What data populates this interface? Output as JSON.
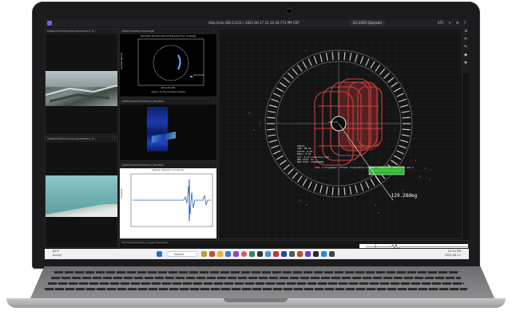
{
  "titlebar": {
    "url": "http://orb-308:11311 / 2025-06-17 12:14:18.773 PM CDT",
    "layout": "G3 2025 Operator",
    "right_items": [
      "UTC",
      "⚲",
      "⚙",
      "?"
    ]
  },
  "panels": {
    "cam_top": {
      "title": "/sibot/vehicle/cameras/camera_fr..."
    },
    "polar": {
      "title": "/sibot/sipedal/coverage",
      "plot_title": "Fwd Right Tank Bounded Alt Expected Floor Coverage",
      "ylabel": "Depth/Height (ft)",
      "xlabel": "Aft-to-Fwd (ft)",
      "legend": "Good Data",
      "footer": "Approx. 2x Floor Surface Covered"
    },
    "scan_blue": {
      "title": "/sibot/whale/sidescan_banded"
    },
    "sonar_plot": {
      "title": "/sibot/whale/sidescan_banded",
      "plot_title": "Sidescan Waveform & Intensity",
      "ylabel": "Amplitude"
    },
    "cam_bottom": {
      "title": "/sibot/vehicle/cameras/camera_fr..."
    },
    "main3d": {
      "title": "",
      "info_lines": [
        "TRACK:",
        "YAW: 98.44",
        "PITCH: 0.03",
        "ROLL: 0.01",
        "ALT: 0.75 Clearance_TOP",
        "MFR STAT: 81",
        "MLR STAT: 418491000"
      ],
      "caption": "Tank 3 Alignment: Offset translation between Inspection Session 2 and 3",
      "heading": "-129.28deg",
      "center_label": "vehicle"
    },
    "bottom_strip": {
      "title": "/sibot/whale/sidescan_image/compressed"
    }
  },
  "sidebar": {
    "icons": [
      "⇲",
      "✕",
      "✎",
      "◆",
      "✥"
    ]
  },
  "taskbar": {
    "weather_temp": "82°F",
    "weather_desc": "Sunny",
    "search_placeholder": "Search",
    "time": "12:14 PM",
    "date": "2025-06-17"
  }
}
